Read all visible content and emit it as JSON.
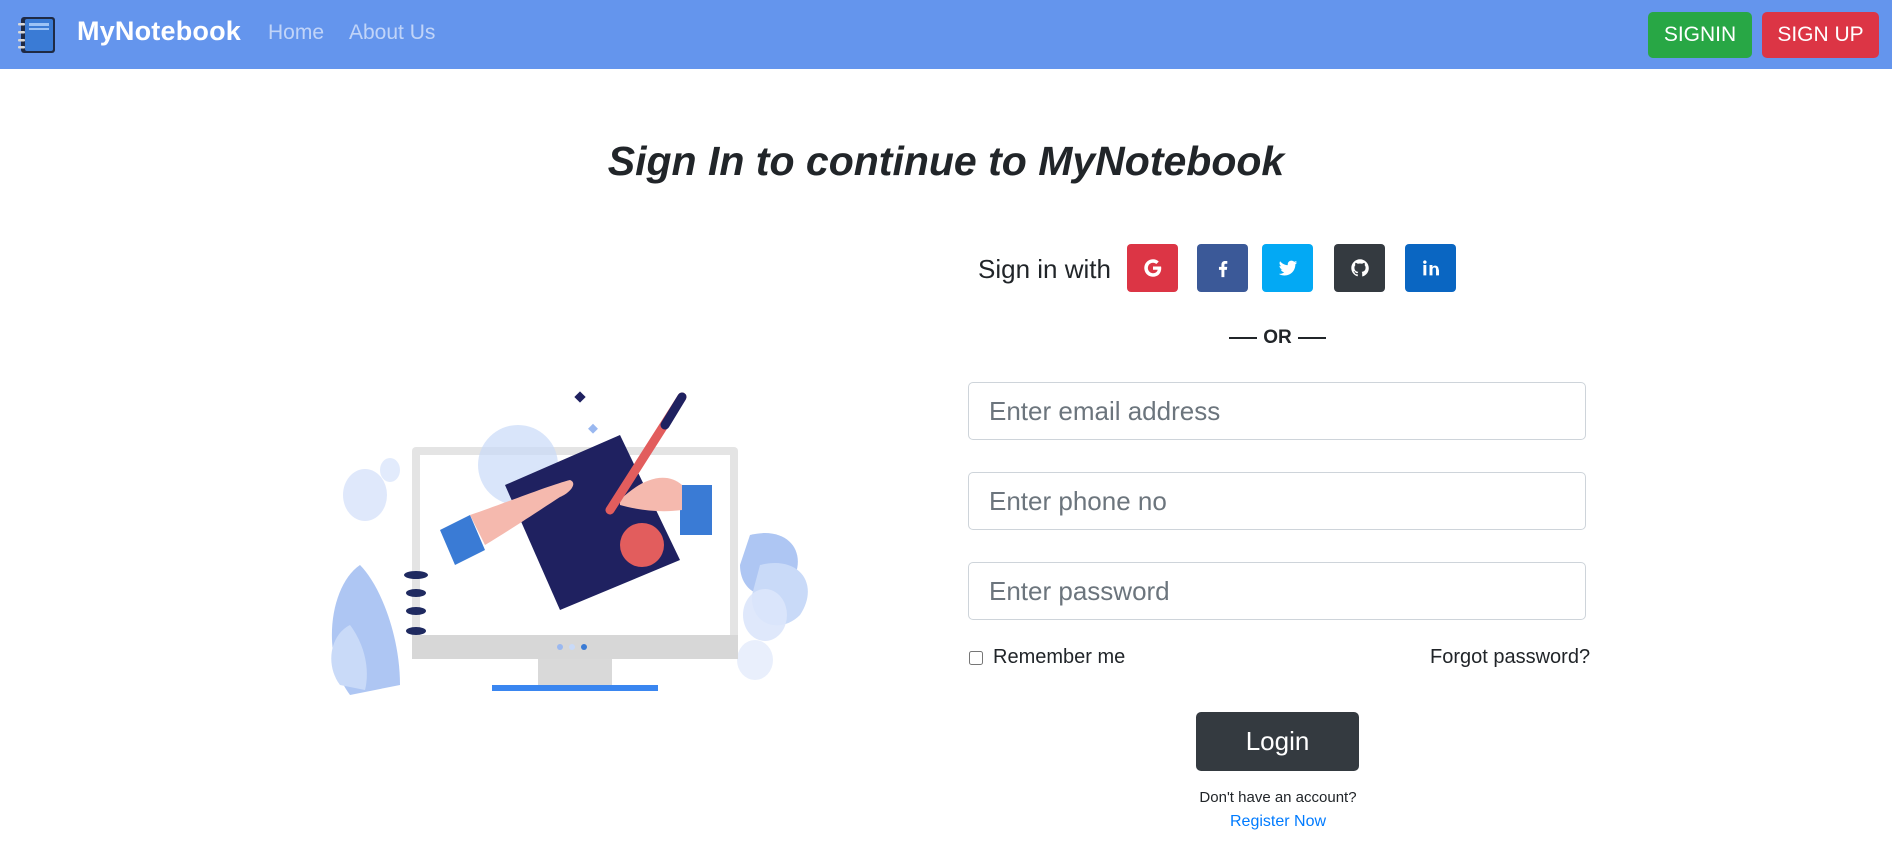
{
  "navbar": {
    "brand": "MyNotebook",
    "links": [
      "Home",
      "About Us"
    ],
    "signin_label": "SIGNIN",
    "signup_label": "SIGN UP",
    "colors": {
      "background": "#6495ed",
      "signin": "#28a745",
      "signup": "#dc3545"
    }
  },
  "page": {
    "heading": "Sign In to continue to MyNotebook"
  },
  "social": {
    "label": "Sign in with",
    "providers": [
      {
        "name": "google",
        "icon": "google-icon",
        "color": "#dc3545"
      },
      {
        "name": "facebook",
        "icon": "facebook-icon",
        "color": "#3b5998"
      },
      {
        "name": "twitter",
        "icon": "twitter-icon",
        "color": "#03a9f4"
      },
      {
        "name": "github",
        "icon": "github-icon",
        "color": "#343a40"
      },
      {
        "name": "linkedin",
        "icon": "linkedin-icon",
        "color": "#0a66c2"
      }
    ],
    "divider": "OR"
  },
  "form": {
    "email_placeholder": "Enter email address",
    "phone_placeholder": "Enter phone no",
    "password_placeholder": "Enter password",
    "remember_label": "Remember me",
    "remember_checked": false,
    "forgot_label": "Forgot password?",
    "login_label": "Login",
    "no_account_text": "Don't have an account?",
    "register_label": "Register Now"
  }
}
